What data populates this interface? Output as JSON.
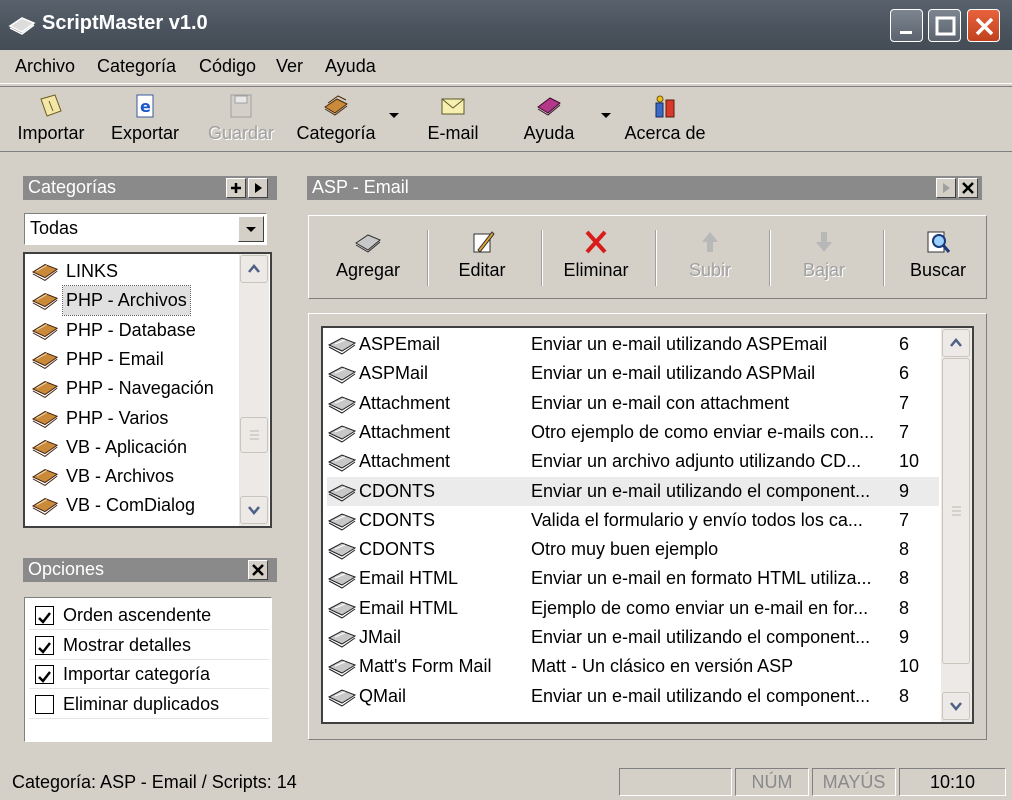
{
  "window": {
    "title": "ScriptMaster v1.0"
  },
  "menu": [
    "Archivo",
    "Categoría",
    "Código",
    "Ver",
    "Ayuda"
  ],
  "toolbar": {
    "importar": "Importar",
    "exportar": "Exportar",
    "guardar": "Guardar",
    "categoria": "Categoría",
    "email": "E-mail",
    "ayuda": "Ayuda",
    "acerca": "Acerca de"
  },
  "categories_panel": {
    "title": "Categorías",
    "filter_value": "Todas",
    "items": [
      {
        "label": "LINKS",
        "selected": false
      },
      {
        "label": "PHP - Archivos",
        "selected": true
      },
      {
        "label": "PHP - Database",
        "selected": false
      },
      {
        "label": "PHP - Email",
        "selected": false
      },
      {
        "label": "PHP - Navegación",
        "selected": false
      },
      {
        "label": "PHP - Varios",
        "selected": false
      },
      {
        "label": "VB - Aplicación",
        "selected": false
      },
      {
        "label": "VB - Archivos",
        "selected": false
      },
      {
        "label": "VB - ComDialog",
        "selected": false
      }
    ]
  },
  "options_panel": {
    "title": "Opciones",
    "items": [
      {
        "label": "Orden ascendente",
        "checked": true
      },
      {
        "label": "Mostrar detalles",
        "checked": true
      },
      {
        "label": "Importar categoría",
        "checked": true
      },
      {
        "label": "Eliminar duplicados",
        "checked": false
      }
    ]
  },
  "scripts_panel": {
    "title": "ASP - Email",
    "actions": {
      "agregar": "Agregar",
      "editar": "Editar",
      "eliminar": "Eliminar",
      "subir": "Subir",
      "bajar": "Bajar",
      "buscar": "Buscar"
    },
    "rows": [
      {
        "name": "ASPEmail",
        "desc": "Enviar un e-mail utilizando ASPEmail",
        "count": "6",
        "selected": false
      },
      {
        "name": "ASPMail",
        "desc": "Enviar un e-mail utilizando ASPMail",
        "count": "6",
        "selected": false
      },
      {
        "name": "Attachment",
        "desc": "Enviar un e-mail con attachment",
        "count": "7",
        "selected": false
      },
      {
        "name": "Attachment",
        "desc": "Otro ejemplo de como enviar e-mails con...",
        "count": "7",
        "selected": false
      },
      {
        "name": "Attachment",
        "desc": "Enviar un archivo adjunto utilizando CD...",
        "count": "10",
        "selected": false
      },
      {
        "name": "CDONTS",
        "desc": "Enviar un e-mail utilizando el component...",
        "count": "9",
        "selected": true
      },
      {
        "name": "CDONTS",
        "desc": "Valida el formulario y envío todos los ca...",
        "count": "7",
        "selected": false
      },
      {
        "name": "CDONTS",
        "desc": "Otro muy buen ejemplo",
        "count": "8",
        "selected": false
      },
      {
        "name": "Email HTML",
        "desc": "Enviar un e-mail en formato HTML utiliza...",
        "count": "8",
        "selected": false
      },
      {
        "name": "Email HTML",
        "desc": "Ejemplo de como enviar un e-mail en for...",
        "count": "8",
        "selected": false
      },
      {
        "name": "JMail",
        "desc": "Enviar un e-mail utilizando el component...",
        "count": "9",
        "selected": false
      },
      {
        "name": "Matt's Form Mail",
        "desc": "Matt - Un clásico en versión ASP",
        "count": "10",
        "selected": false
      },
      {
        "name": "QMail",
        "desc": "Enviar un e-mail utilizando el component...",
        "count": "8",
        "selected": false
      }
    ]
  },
  "statusbar": {
    "text": "Categoría: ASP - Email / Scripts: 14",
    "num": "NÚM",
    "mayus": "MAYÚS",
    "time": "10:10"
  },
  "colors": {
    "titlebar": "#4b545e",
    "close_button": "#d4502c",
    "panel_header": "#8a8a8a",
    "window_bg": "#d4d0c8",
    "delete_icon": "#d81b1b"
  }
}
